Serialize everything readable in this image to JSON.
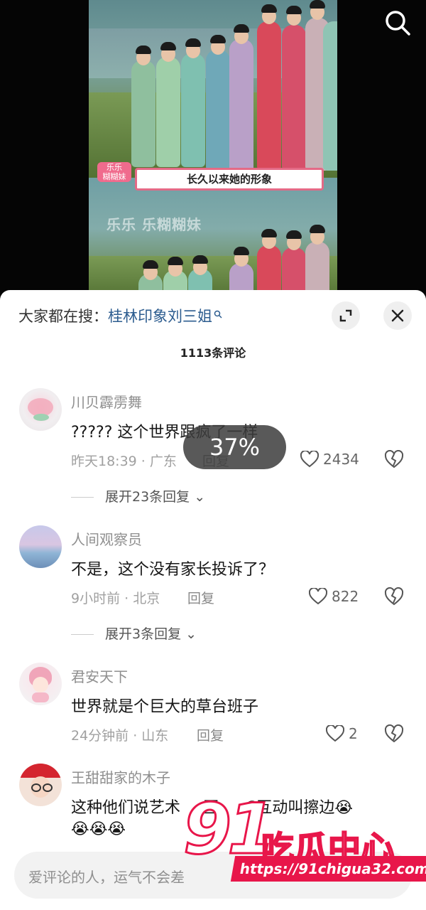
{
  "video": {
    "caption": "长久以来她的形象",
    "tag": "乐乐\n糊糊妹",
    "watermark": "乐乐 乐糊糊妹"
  },
  "panel": {
    "suggest_prefix": "大家都在搜：",
    "suggest_keyword": "桂林印象刘三姐",
    "comment_count": "1113条评论"
  },
  "comments": [
    {
      "user": "川贝霹雳舞",
      "text": "?????  这个世界跟疯了一样",
      "meta": "昨天18:39 · 广东",
      "reply": "回复",
      "likes": "2434",
      "expand": "展开23条回复"
    },
    {
      "user": "人间观察员",
      "text": "不是，这个没有家长投诉了？",
      "meta": "9小时前 · 北京",
      "reply": "回复",
      "likes": "822",
      "expand": "展开3条回复"
    },
    {
      "user": "君安天下",
      "text": "世界就是个巨大的草台班子",
      "meta": "24分钟前 · 山东",
      "reply": "回复",
      "likes": "2"
    },
    {
      "user": "王甜甜家的木子",
      "text": "这种他们说艺术",
      "text2": "区",
      "text3": "C互动叫擦边😭",
      "emojis": "😭😭😭"
    }
  ],
  "overlay": {
    "progress": "37%"
  },
  "input": {
    "placeholder": "爱评论的人，运气不会差"
  },
  "brand": {
    "number": "91",
    "name": "吃瓜中心",
    "url": "https://91chigua32.com"
  }
}
